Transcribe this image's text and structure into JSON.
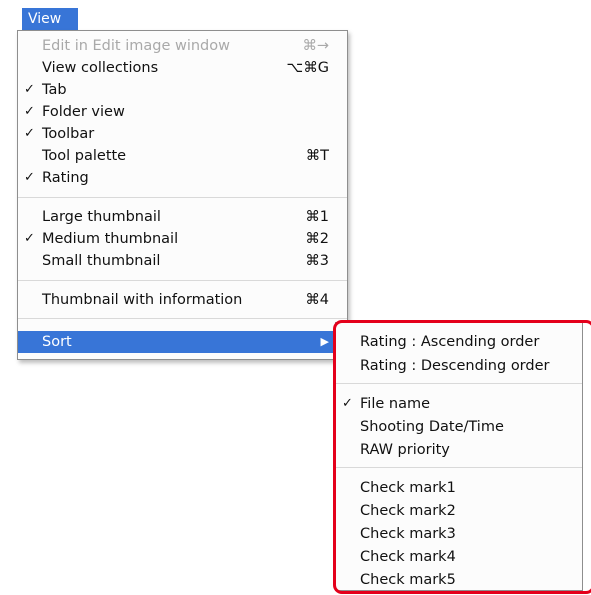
{
  "menubar": {
    "title": "View"
  },
  "menu": {
    "items": [
      {
        "label": "Edit in Edit image window",
        "shortcut": "⌘→",
        "check": ""
      },
      {
        "label": "View collections",
        "shortcut": "⌥⌘G",
        "check": ""
      },
      {
        "label": "Tab",
        "shortcut": "",
        "check": "✓"
      },
      {
        "label": "Folder view",
        "shortcut": "",
        "check": "✓"
      },
      {
        "label": "Toolbar",
        "shortcut": "",
        "check": "✓"
      },
      {
        "label": "Tool palette",
        "shortcut": "⌘T",
        "check": ""
      },
      {
        "label": "Rating",
        "shortcut": "",
        "check": "✓"
      },
      {
        "label": "Large thumbnail",
        "shortcut": "⌘1",
        "check": ""
      },
      {
        "label": "Medium thumbnail",
        "shortcut": "⌘2",
        "check": "✓"
      },
      {
        "label": "Small thumbnail",
        "shortcut": "⌘3",
        "check": ""
      },
      {
        "label": "Thumbnail with information",
        "shortcut": "⌘4",
        "check": ""
      },
      {
        "label": "Sort",
        "arrow": "▶"
      }
    ]
  },
  "submenu": {
    "items": [
      {
        "label": "Rating : Ascending order",
        "check": ""
      },
      {
        "label": "Rating : Descending order",
        "check": ""
      },
      {
        "label": "File name",
        "check": "✓"
      },
      {
        "label": "Shooting Date/Time",
        "check": ""
      },
      {
        "label": "RAW priority",
        "check": ""
      },
      {
        "label": "Check mark1",
        "check": ""
      },
      {
        "label": "Check mark2",
        "check": ""
      },
      {
        "label": "Check mark3",
        "check": ""
      },
      {
        "label": "Check mark4",
        "check": ""
      },
      {
        "label": "Check mark5",
        "check": ""
      }
    ]
  },
  "colors": {
    "highlight": "#3875d7",
    "annotation_frame": "#e4001b",
    "disabled_text": "#a9a9a9"
  }
}
